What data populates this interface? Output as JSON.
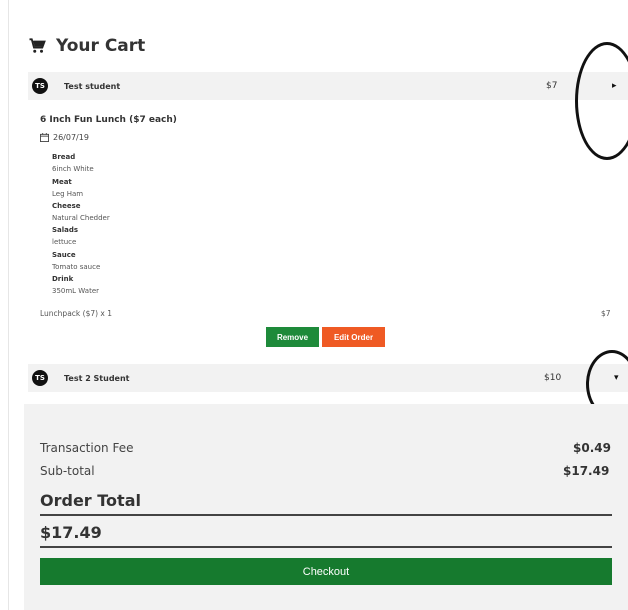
{
  "cart": {
    "title": "Your Cart",
    "icon": "shopping-cart-icon"
  },
  "students": [
    {
      "initials": "TS",
      "name": "Test student",
      "price": "$7",
      "arrow": "▸"
    },
    {
      "initials": "TS",
      "name": "Test 2 Student",
      "price": "$10",
      "arrow": "▾"
    }
  ],
  "order": {
    "item_title": "6 Inch Fun Lunch ($7 each)",
    "date": "26/07/19",
    "details": [
      {
        "label": "Bread",
        "value": "6inch White"
      },
      {
        "label": "Meat",
        "value": "Leg Ham"
      },
      {
        "label": "Cheese",
        "value": "Natural Chedder"
      },
      {
        "label": "Salads",
        "value": "lettuce"
      },
      {
        "label": "Sauce",
        "value": "Tomato sauce"
      },
      {
        "label": "Drink",
        "value": "350mL Water"
      }
    ],
    "pack_line": "Lunchpack ($7) x 1",
    "pack_price": "$7",
    "remove_label": "Remove",
    "edit_label": "Edit Order"
  },
  "summary": {
    "fee_label": "Transaction Fee",
    "fee_value": "$0.49",
    "subtotal_label": "Sub-total",
    "subtotal_value": "$17.49",
    "total_label": "Order Total",
    "total_value": "$17.49",
    "checkout_label": "Checkout"
  },
  "colors": {
    "green": "#1e8a3a",
    "orange": "#ef5a24",
    "panel": "#f2f2f2"
  }
}
